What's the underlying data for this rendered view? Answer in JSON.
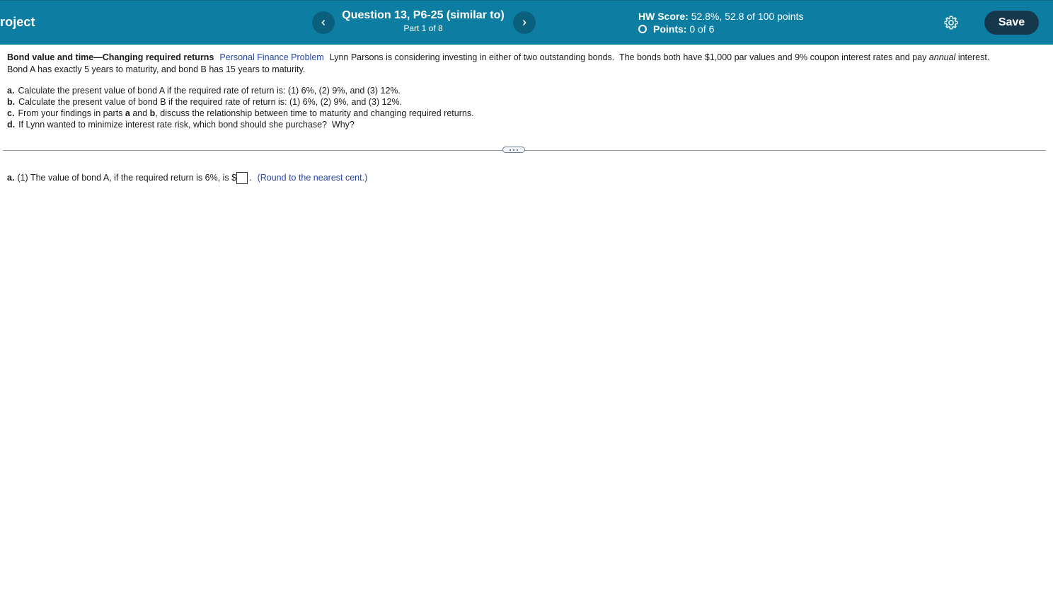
{
  "header": {
    "project_title": "roject",
    "question_title": "Question 13, P6-25 (similar to)",
    "question_part": "Part 1 of 8",
    "hw_score_label": "HW Score:",
    "hw_score_value": "52.8%, 52.8 of 100 points",
    "points_label": "Points:",
    "points_value": "0 of 6",
    "save_label": "Save",
    "icons": {
      "prev": "chevron-left-icon",
      "next": "chevron-right-icon",
      "settings": "gear-icon",
      "points_status": "circle-icon"
    },
    "colors": {
      "bar": "#0d7ea1",
      "save": "#16384c",
      "nav": "#0a5f7c"
    }
  },
  "problem": {
    "title": "Bond value and time—Changing required returns",
    "tag": "Personal Finance Problem",
    "intro_before_italic": "Lynn Parsons is considering investing in either of two outstanding bonds.  The bonds both have $1,000 par values and 9% coupon interest rates and pay ",
    "intro_italic": "annual",
    "intro_after_italic": " interest.",
    "intro_line2": "Bond A has exactly 5 years to maturity, and bond B has 15 years to maturity."
  },
  "parts": {
    "a": {
      "letter": "a.",
      "text": "Calculate the present value of bond A if the required rate of return is: (1) 6%, (2) 9%, and (3) 12%."
    },
    "b": {
      "letter": "b.",
      "text": "Calculate the present value of bond B if the required rate of return is: (1) 6%, (2) 9%, and (3) 12%."
    },
    "c": {
      "letter": "c.",
      "text_1": "From your findings in parts ",
      "bold_1": "a",
      "text_2": " and ",
      "bold_2": "b",
      "text_3": ", discuss the relationship between time to maturity and changing required returns."
    },
    "d": {
      "letter": "d.",
      "text": "If Lynn wanted to minimize interest rate risk, which bond should she purchase?  Why?"
    }
  },
  "answer": {
    "letter": "a.",
    "prompt": "(1) The value of bond A, if the required return is 6%, is $",
    "value": "",
    "after": ".",
    "hint": "(Round to the nearest cent.)"
  }
}
